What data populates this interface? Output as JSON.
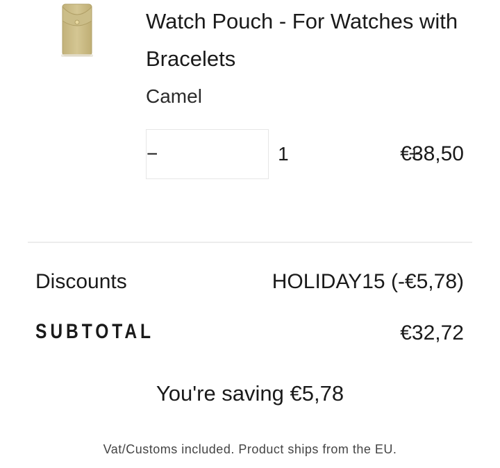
{
  "product": {
    "image": "watch-pouch-thumbnail",
    "title": "Watch Pouch - For Watches with Bracelets",
    "variant": "Camel",
    "quantity": "1",
    "price": "€38,50",
    "decrement_icon": "minus-icon",
    "increment_icon": "plus-icon",
    "pouch_color": "#cfc08a"
  },
  "totals": {
    "discounts_label": "Discounts",
    "discounts_value": "HOLIDAY15 (-€5,78)",
    "subtotal_label": "SUBTOTAL",
    "subtotal_value": "€32,72"
  },
  "saving_text": "You're saving €5,78",
  "footer_note": "Vat/Customs included. Product ships from the EU."
}
